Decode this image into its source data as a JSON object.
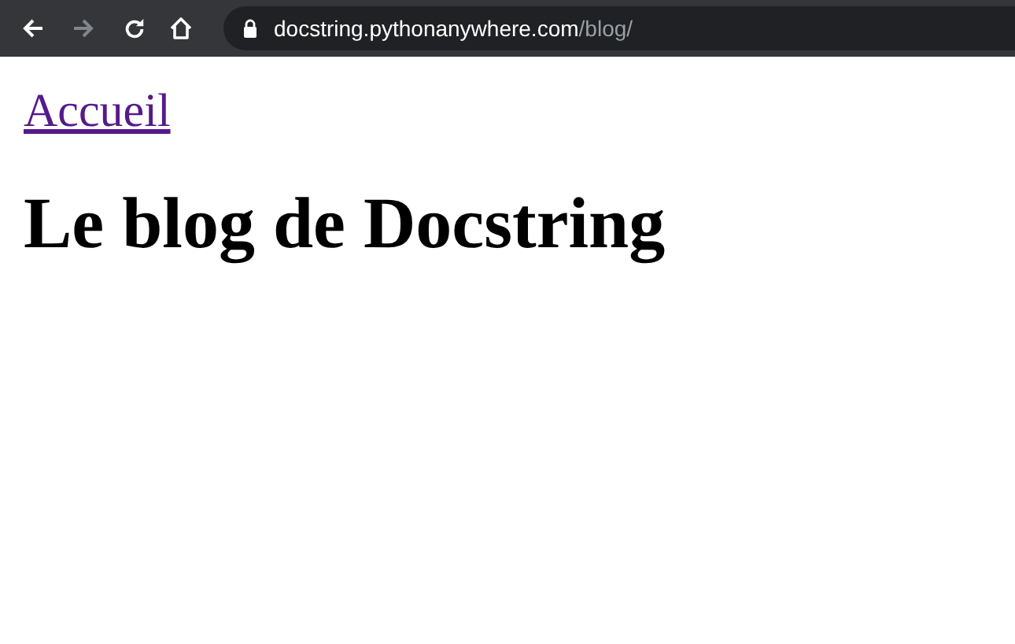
{
  "browser": {
    "back": {
      "disabled": false
    },
    "forward": {
      "disabled": true
    },
    "address": {
      "secure": true,
      "host": "docstring.pythonanywhere.com",
      "path": "/blog/"
    }
  },
  "page": {
    "nav_link": {
      "text": "Accueil",
      "visited": true
    },
    "heading": "Le blog de Docstring"
  }
}
